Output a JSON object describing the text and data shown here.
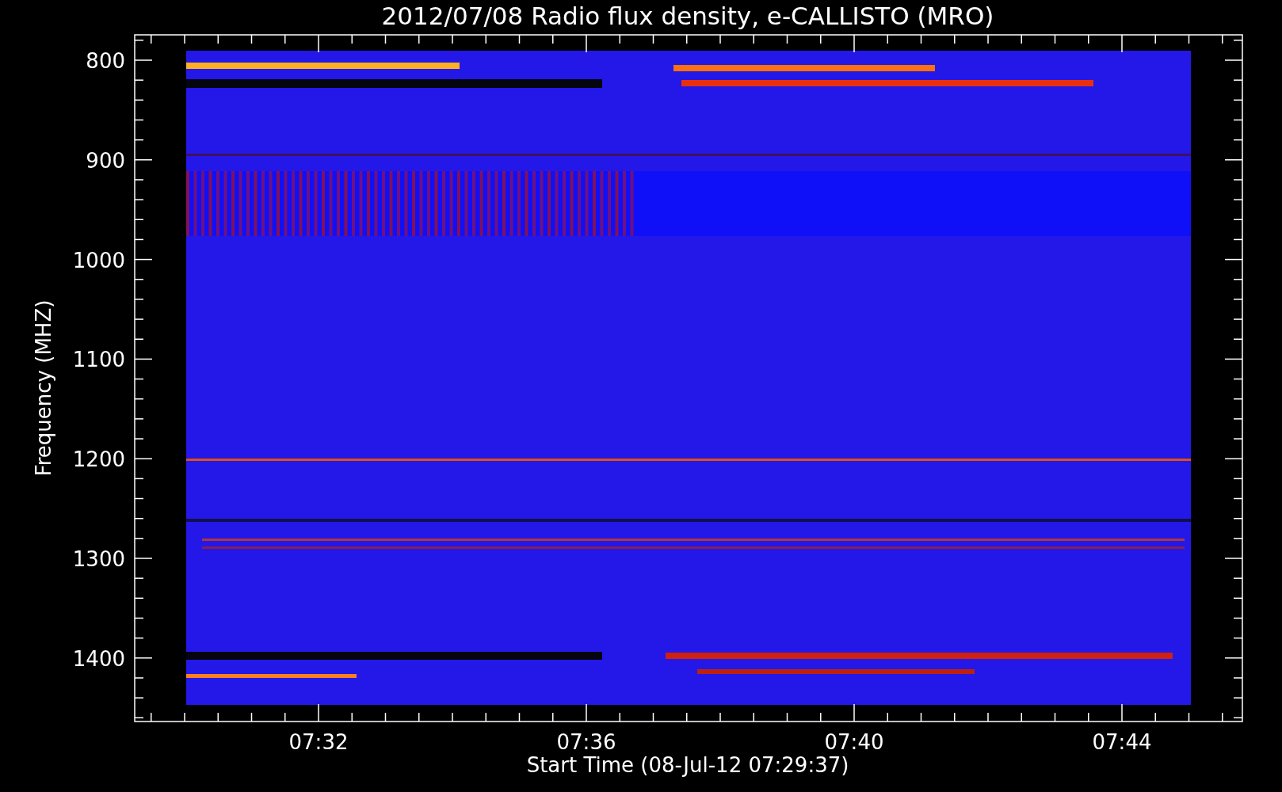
{
  "title": "2012/07/08  Radio flux density, e-CALLISTO (MRO)",
  "y_axis": {
    "label": "Frequency (MHZ)",
    "ticks": [
      "800",
      "900",
      "1000",
      "1100",
      "1200",
      "1300",
      "1400"
    ]
  },
  "x_axis": {
    "label": "Start Time (08-Jul-12 07:29:37)",
    "ticks": [
      "07:32",
      "07:36",
      "07:40",
      "07:44"
    ]
  }
}
